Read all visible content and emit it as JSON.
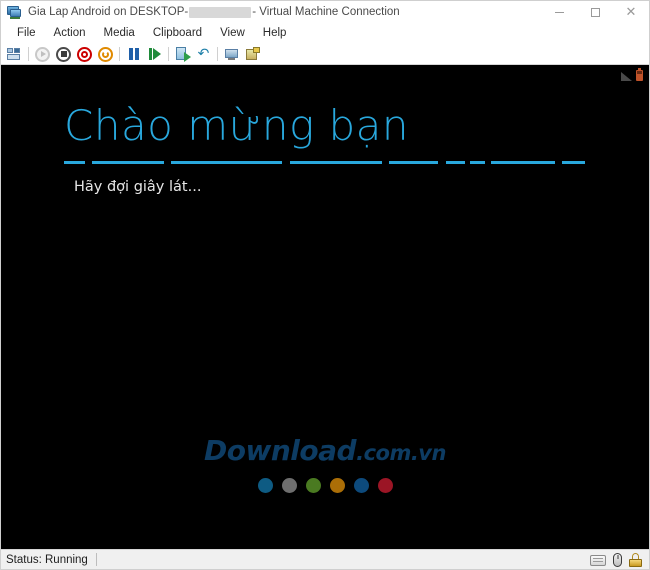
{
  "window": {
    "title_prefix": "Gia Lap Android on DESKTOP-",
    "title_suffix": " - Virtual Machine Connection",
    "app_icon": "virtual-machine-icon",
    "controls": {
      "minimize": "—",
      "maximize": "□",
      "close": "✕"
    }
  },
  "menubar": {
    "items": [
      {
        "label": "File"
      },
      {
        "label": "Action"
      },
      {
        "label": "Media"
      },
      {
        "label": "Clipboard"
      },
      {
        "label": "View"
      },
      {
        "label": "Help"
      }
    ]
  },
  "toolbar": {
    "buttons": [
      {
        "name": "ctrl-alt-delete-icon",
        "title": "Ctrl+Alt+Delete"
      },
      {
        "name": "start-icon",
        "title": "Start",
        "disabled": true
      },
      {
        "name": "shutdown-icon",
        "title": "Shut Down"
      },
      {
        "name": "turn-off-icon",
        "title": "Turn Off"
      },
      {
        "name": "reset-icon",
        "title": "Reset"
      },
      {
        "name": "pause-icon",
        "title": "Pause"
      },
      {
        "name": "resume-icon",
        "title": "Resume"
      },
      {
        "name": "checkpoint-icon",
        "title": "Checkpoint"
      },
      {
        "name": "revert-icon",
        "title": "Revert"
      },
      {
        "name": "basic-session-icon",
        "title": "Basic Session"
      },
      {
        "name": "enhanced-session-icon",
        "title": "Enhanced Session"
      }
    ]
  },
  "vm_screen": {
    "background": "#000000",
    "android_status": {
      "signal_icon": "signal-triangle-icon",
      "battery_icon": "battery-icon"
    },
    "welcome": {
      "title": "Chào mừng bạn",
      "subtitle": "Hãy đợi giây lát...",
      "accent_color": "#29a8dd",
      "subtitle_color": "#e6e6e6",
      "divider_segments": [
        {
          "len": 22,
          "gap": 8
        },
        {
          "len": 76,
          "gap": 8
        },
        {
          "len": 118,
          "gap": 8
        },
        {
          "len": 98,
          "gap": 8
        },
        {
          "len": 52,
          "gap": 8
        },
        {
          "len": 20,
          "gap": 6
        },
        {
          "len": 16,
          "gap": 6
        },
        {
          "len": 68,
          "gap": 8
        },
        {
          "len": 24,
          "gap": 0
        }
      ]
    },
    "watermark": {
      "brand": "Download",
      "suffix": ".com.vn",
      "color": "#0d3c63",
      "dots": [
        {
          "name": "dot-teal",
          "color": "#0e5b83"
        },
        {
          "name": "dot-gray",
          "color": "#6e6e6e"
        },
        {
          "name": "dot-green",
          "color": "#4a7a21"
        },
        {
          "name": "dot-amber",
          "color": "#ab6e07"
        },
        {
          "name": "dot-blue",
          "color": "#0d4a7c"
        },
        {
          "name": "dot-red",
          "color": "#9b1525"
        }
      ]
    }
  },
  "statusbar": {
    "status": "Status: Running",
    "icons": [
      {
        "name": "keyboard-icon"
      },
      {
        "name": "mouse-icon"
      },
      {
        "name": "lock-icon"
      }
    ]
  }
}
